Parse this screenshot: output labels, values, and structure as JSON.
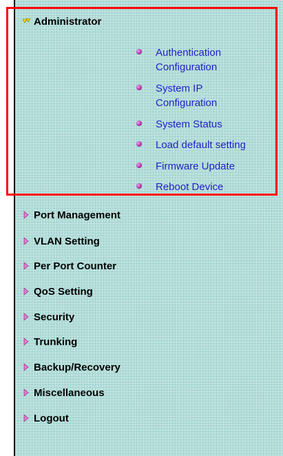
{
  "menu": {
    "admin": {
      "label": "Administrator",
      "icon": "expanded-arrow-icon"
    },
    "submenu": [
      {
        "line1": "Authentication",
        "line2": "Configuration"
      },
      {
        "line1": "System IP",
        "line2": "Configuration"
      },
      {
        "line1": "System Status",
        "line2": ""
      },
      {
        "line1": "Load default setting",
        "line2": ""
      },
      {
        "line1": "Firmware Update",
        "line2": ""
      },
      {
        "line1": "Reboot Device",
        "line2": ""
      }
    ],
    "items": [
      "Port Management",
      "VLAN Setting",
      "Per Port Counter",
      "QoS Setting",
      "Security",
      "Trunking",
      "Backup/Recovery",
      "Miscellaneous",
      "Logout"
    ]
  },
  "colors": {
    "panel_bg": "#a8d7d3",
    "link": "#2222c8",
    "highlight": "#ff0000"
  }
}
